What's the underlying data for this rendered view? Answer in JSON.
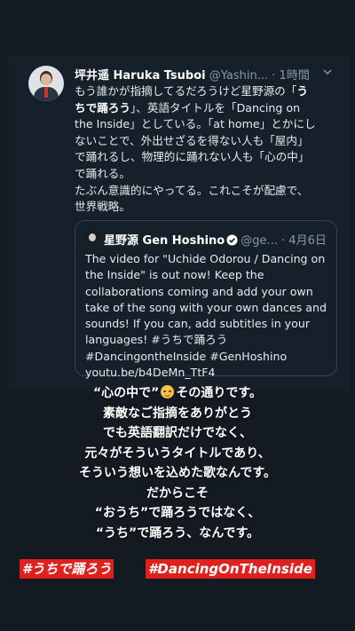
{
  "tweet": {
    "author_name": "坪井遥 Haruka Tsuboi",
    "author_handle": "@Yashin...",
    "time": "· 1時間",
    "body": {
      "line1_a": "もう誰かが指摘してるだろうけど星野源の「",
      "line1_b": "う",
      "line2_a": "ちで踊ろう",
      "line2_b": "」、英語タイトルを「Dancing on",
      "line3": "the Inside」としている。「at home」とかにし",
      "line4": "ないことで、外出せざるを得ない人も「屋内」",
      "line5": "で踊れるし、物理的に踊れない人も「心の中」",
      "line6": "で踊れる。",
      "line7": "たぶん意識的にやってる。これこそが配慮で、",
      "line8": "世界戦略。"
    }
  },
  "quoted_tweet": {
    "author_name": "星野源 Gen Hoshino",
    "author_handle": "@ge...",
    "date": "· 4月6日",
    "lines": [
      "The video for \"Uchide Odorou / Dancing on",
      "the Inside\" is out now! Keep the",
      "collaborations coming and add your own",
      "take of the song with your own dances and",
      "sounds! If you can, add subtitles in your",
      "languages! #うちで踊ろう",
      "#DancingontheInside #GenHoshino",
      "youtu.be/b4DeMn_TtF4"
    ]
  },
  "story_overlay": {
    "line1_a": "“心の中で”",
    "line1_b": "その通りです。",
    "line2": "素敵なご指摘をありがとう",
    "line3": "でも英語翻訳だけでなく、",
    "line4": "元々がそういうタイトルであり、",
    "line5": "そういう想いを込めた歌なんです。",
    "line6": "だからこそ",
    "line7": "“おうち”で踊ろうではなく、",
    "line8": "“うち”で踊ろう、なんです。"
  },
  "hashtags": {
    "tag1": "#うちで踊ろう",
    "tag2": "#DancingOnTheInside"
  },
  "colors": {
    "background": "#141a21",
    "card": "#15202b",
    "hashtag_bg": "#e0201c",
    "verified": "#1da1f2"
  },
  "icons": [
    "avatar",
    "chevron-down-icon",
    "verified-icon",
    "smiling-face-emoji"
  ]
}
